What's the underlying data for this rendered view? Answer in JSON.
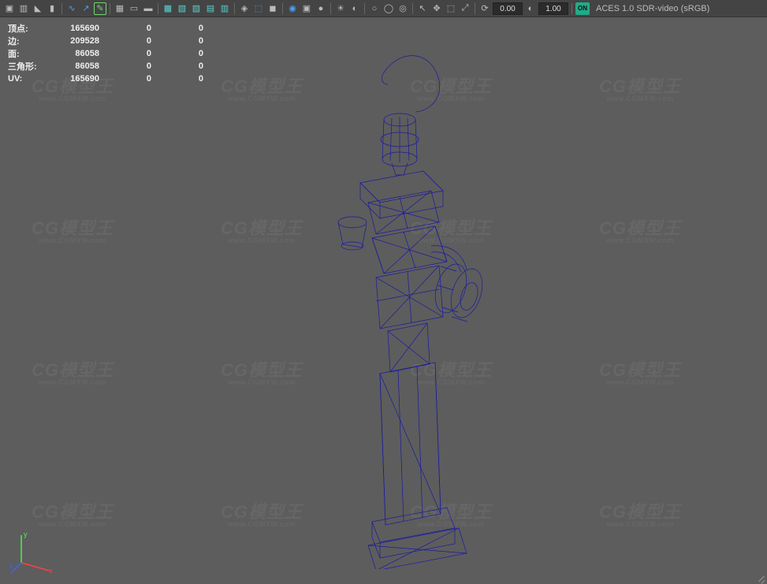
{
  "toolbar": {
    "num1": "0.00",
    "num2": "1.00",
    "on_badge": "ON",
    "color_space": "ACES 1.0 SDR-video (sRGB)"
  },
  "stats": [
    {
      "label": "顶点:",
      "v1": "165690",
      "v2": "0",
      "v3": "0"
    },
    {
      "label": "边:",
      "v1": "209528",
      "v2": "0",
      "v3": "0"
    },
    {
      "label": "面:",
      "v1": "86058",
      "v2": "0",
      "v3": "0"
    },
    {
      "label": "三角形:",
      "v1": "86058",
      "v2": "0",
      "v3": "0"
    },
    {
      "label": "UV:",
      "v1": "165690",
      "v2": "0",
      "v3": "0"
    }
  ],
  "watermark": {
    "brand": "CG模型王",
    "url": "www.CGMXW.com"
  },
  "axis": {
    "x": "x",
    "y": "y",
    "z": "z"
  }
}
